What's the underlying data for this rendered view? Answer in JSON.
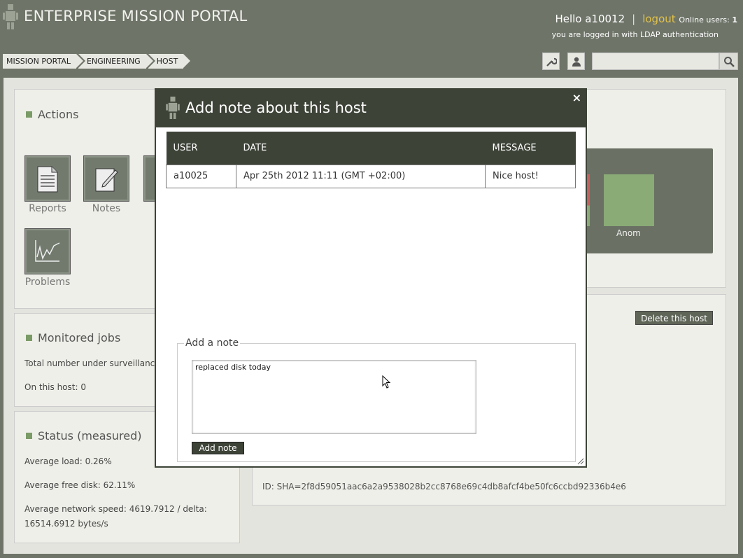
{
  "header": {
    "title": "ENTERPRISE MISSION PORTAL",
    "hello": "Hello a10012",
    "separator": "|",
    "logout": "logout",
    "online_label": "Online users:",
    "online_count": "1",
    "auth_note": "you are logged in with LDAP authentication"
  },
  "breadcrumb": [
    "MISSION PORTAL",
    "ENGINEERING",
    "HOST"
  ],
  "actions": {
    "title": "Actions",
    "items": [
      "Reports",
      "Notes",
      "Problems"
    ]
  },
  "monitored": {
    "title": "Monitored jobs",
    "total": "Total number under surveillanc",
    "host": "On this host: 0"
  },
  "status": {
    "title": "Status (measured)",
    "load": "Average load: 0.26%",
    "disk": "Average free disk: 62.11%",
    "network": "Average network speed: 4619.7912 / delta: 16514.6912 bytes/s"
  },
  "right": {
    "anom_label": "Anom",
    "delete_button": "Delete this host",
    "id": "ID: SHA=2f8d59051aac6a2a9538028b2cc8768e69c4db8afcf4be50fc6ccbd92336b4e6"
  },
  "dialog": {
    "title": "Add note about this host",
    "close": "×",
    "columns": [
      "USER",
      "DATE",
      "MESSAGE"
    ],
    "rows": [
      {
        "user": "a10025",
        "date": "Apr 25th 2012 11:11 (GMT +02:00)",
        "message": "Nice host!"
      }
    ],
    "legend": "Add a note",
    "note_value": "replaced disk today",
    "add_button": "Add note"
  }
}
